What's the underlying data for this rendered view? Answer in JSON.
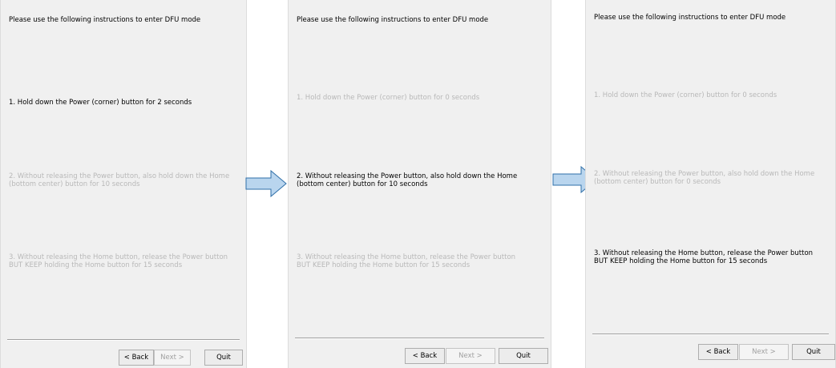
{
  "panels": [
    {
      "heading": "Please use the following instructions to enter DFU mode",
      "step1": "1. Hold down the Power (corner) button for 2 seconds",
      "step2": [
        "2. Without releasing the Power button, also hold down the Home",
        "(bottom center) button for 10 seconds"
      ],
      "step3": [
        "3. Without releasing the Home button, release the Power button",
        "BUT KEEP holding the Home button for 15 seconds"
      ],
      "back_label": "< Back",
      "next_label": "Next >",
      "quit_label": "Quit"
    },
    {
      "heading": "Please use the following instructions to enter DFU mode",
      "step1": "1. Hold down the Power (corner) button for 0 seconds",
      "step2": [
        "2. Without releasing the Power button, also hold down the Home",
        "(bottom center) button for 10 seconds"
      ],
      "step3": [
        "3. Without releasing the Home button, release the Power button",
        "BUT KEEP holding the Home button for 15 seconds"
      ],
      "back_label": "< Back",
      "next_label": "Next >",
      "quit_label": "Quit"
    },
    {
      "heading": "Please use the following instructions to enter DFU mode",
      "step1": "1. Hold down the Power (corner) button for 0 seconds",
      "step2": [
        "2. Without releasing the Power button, also hold down the Home",
        "(bottom center) button for 0 seconds"
      ],
      "step3": [
        "3. Without releasing the Home button, release the Power button",
        "BUT KEEP holding the Home button for 15 seconds"
      ],
      "back_label": "< Back",
      "next_label": "Next >",
      "quit_label": "Quit"
    }
  ],
  "colors": {
    "panel_bg": "#f0f0f0",
    "active_text": "#000000",
    "inactive_text": "#b8b8b8",
    "arrow_fill": "#b9d5ee",
    "arrow_stroke": "#2f6fa8"
  },
  "icons": [
    "right-arrow-icon",
    "right-arrow-icon"
  ]
}
